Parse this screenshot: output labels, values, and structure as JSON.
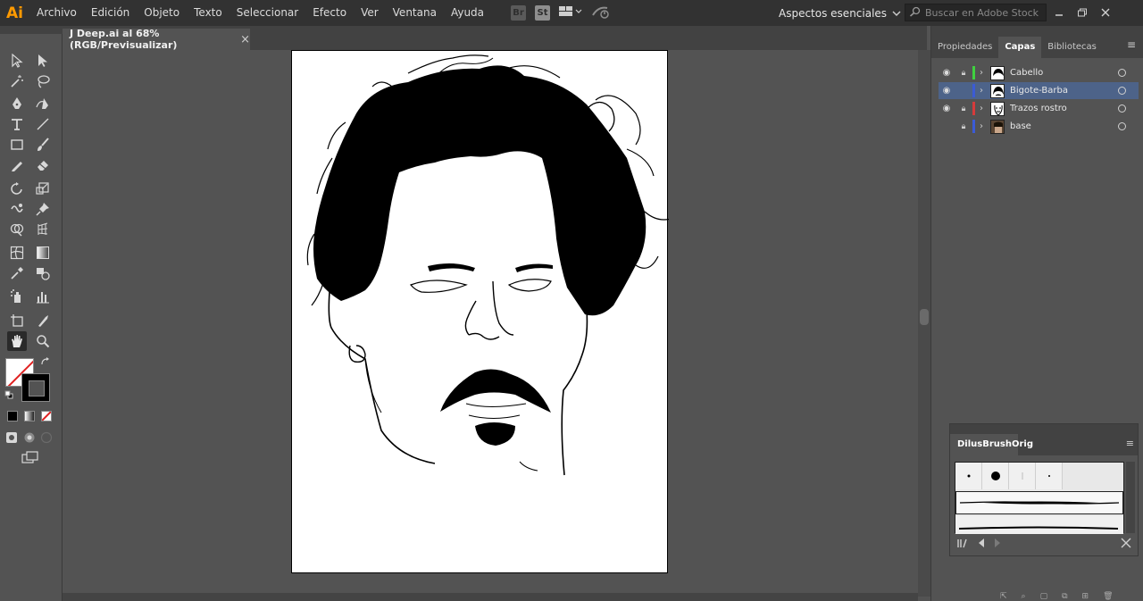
{
  "app": {
    "logo": "Ai",
    "menu": [
      "Archivo",
      "Edición",
      "Objeto",
      "Texto",
      "Seleccionar",
      "Efecto",
      "Ver",
      "Ventana",
      "Ayuda"
    ],
    "bridge_icon": "Br",
    "stock_icon": "St",
    "workspace": "Aspectos esenciales",
    "search_placeholder": "Buscar en Adobe Stock"
  },
  "document": {
    "tab_title": "J Deep.ai al 68% (RGB/Previsualizar)",
    "close_glyph": "×"
  },
  "panels": {
    "tabs": [
      "Propiedades",
      "Capas",
      "Bibliotecas"
    ],
    "active_tab": "Capas",
    "layers": [
      {
        "name": "Cabello",
        "visible": true,
        "locked": true,
        "color": "#3fd13f",
        "selected": false
      },
      {
        "name": "Bigote-Barba",
        "visible": true,
        "locked": false,
        "color": "#3b5bd6",
        "selected": true
      },
      {
        "name": "Trazos rostro",
        "visible": true,
        "locked": true,
        "color": "#d63b3b",
        "selected": false
      },
      {
        "name": "base",
        "visible": false,
        "locked": true,
        "color": "#3b5bd6",
        "selected": false
      }
    ]
  },
  "brushes": {
    "tab": "DilusBrushOrig"
  },
  "colors": {
    "fill": "none",
    "stroke": "#000000",
    "accent_selected": "#4d6389"
  },
  "icons": [
    "selection-icon",
    "direct-selection-icon",
    "magic-wand-icon",
    "lasso-icon",
    "pen-icon",
    "curvature-icon",
    "type-icon",
    "line-icon",
    "rectangle-icon",
    "paintbrush-icon",
    "pencil-icon",
    "eraser-icon",
    "rotate-icon",
    "scale-icon",
    "warp-icon",
    "pin-icon",
    "shape-builder-icon",
    "perspective-icon",
    "mesh-icon",
    "gradient-icon",
    "eyedropper-icon",
    "blend-icon",
    "symbol-sprayer-icon",
    "graph-icon",
    "artboard-icon",
    "slice-icon",
    "hand-icon",
    "zoom-icon"
  ]
}
